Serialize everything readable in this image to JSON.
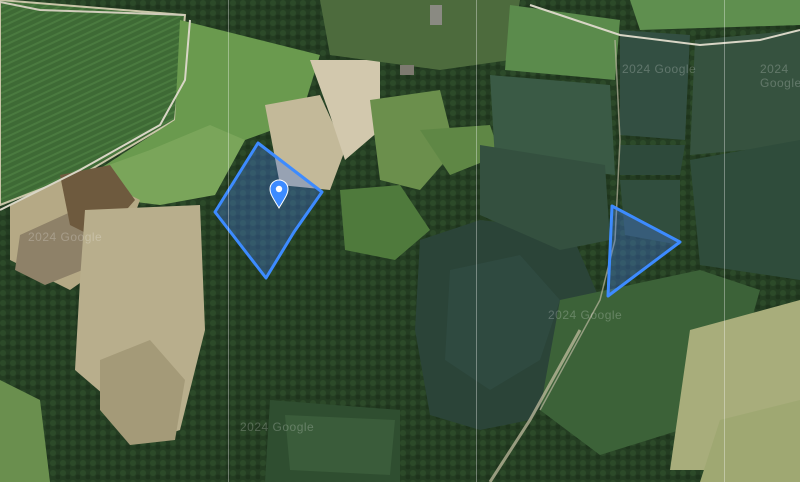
{
  "map": {
    "view": "satellite",
    "watermarks": [
      "2024 Google",
      "2024 Google",
      "2024 Google",
      "2024 Google",
      "2024 Google"
    ],
    "marker_icon": "location-pin-icon",
    "parcel_outline_color": "#3d8bff",
    "parcel_fill_color": "rgba(70,120,230,0.35)",
    "parcels": [
      "parcel-west",
      "parcel-east"
    ]
  }
}
